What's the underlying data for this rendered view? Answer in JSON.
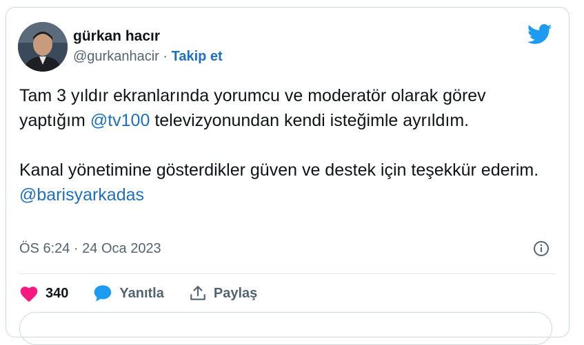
{
  "user": {
    "name": "gürkan hacır",
    "handle": "@gurkanhacir",
    "separator": "·",
    "follow_label": "Takip et"
  },
  "tweet": {
    "p1_before": "Tam 3 yıldır ekranlarında yorumcu ve moderatör olarak görev yaptığım ",
    "p1_mention": "@tv100",
    "p1_after": " televizyonundan kendi isteğimle ayrıldım.",
    "p2_before": "Kanal yönetimine gösterdikler güven ve destek için teşekkür ederim. ",
    "p2_mention": "@barisyarkadas"
  },
  "meta": {
    "timestamp": "ÖS 6:24 · 24 Oca 2023"
  },
  "actions": {
    "like_count": "340",
    "reply_label": "Yanıtla",
    "share_label": "Paylaş"
  },
  "more": {
    "label": ""
  },
  "icons": {
    "brand": "twitter-bird-icon",
    "info": "info-icon",
    "like": "heart-icon",
    "reply": "speech-bubble-icon",
    "share": "share-icon"
  },
  "colors": {
    "brand_blue": "#1d9bf0",
    "link_blue": "#1d6fc2",
    "heart": "#f91880",
    "muted": "#536471",
    "text": "#0f1419",
    "border": "#cfd9de"
  }
}
